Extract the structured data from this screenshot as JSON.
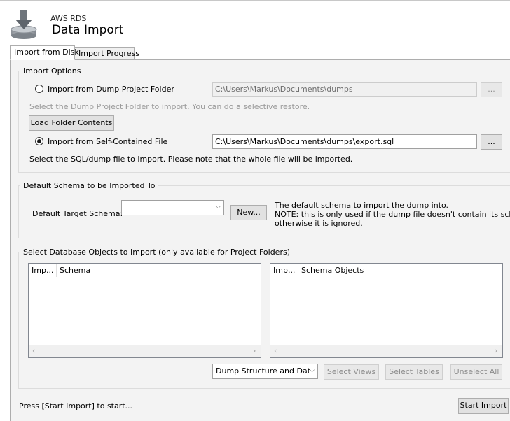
{
  "header": {
    "connection_name": "AWS RDS",
    "title": "Data Import"
  },
  "tabs": [
    {
      "label": "Import from Disk",
      "active": true
    },
    {
      "label": "Import Progress",
      "active": false
    }
  ],
  "import_options": {
    "title": "Import Options",
    "dump_folder_radio": "Import from Dump Project Folder",
    "dump_folder_path": "C:\\Users\\Markus\\Documents\\dumps",
    "dump_folder_browse": "...",
    "dump_folder_hint": "Select the Dump Project Folder to import. You can do a selective restore.",
    "load_folder_button": "Load Folder Contents",
    "self_contained_radio": "Import from Self-Contained File",
    "self_contained_path": "C:\\Users\\Markus\\Documents\\dumps\\export.sql",
    "self_contained_browse": "...",
    "self_contained_hint": "Select the SQL/dump file to import. Please note that the whole file will be imported.",
    "selected": "self_contained"
  },
  "default_schema": {
    "title": "Default Schema to be Imported To",
    "target_label": "Default Target Schema:",
    "target_value": "",
    "new_button": "New...",
    "note_line1": "The default schema to import the dump into.",
    "note_line2": "NOTE: this is only used if the dump file doesn't contain its schema,",
    "note_line3": "otherwise it is ignored."
  },
  "objects": {
    "title": "Select Database Objects to Import (only available for Project Folders)",
    "schema_list": {
      "col_import": "Imp...",
      "col_name": "Schema"
    },
    "objects_list": {
      "col_import": "Imp...",
      "col_name": "Schema Objects"
    },
    "dump_mode": "Dump Structure and Dat",
    "select_views": "Select Views",
    "select_tables": "Select Tables",
    "unselect_all": "Unselect All"
  },
  "footer": {
    "status": "Press [Start Import] to start...",
    "start_button": "Start Import"
  },
  "colors": {
    "panel_bg": "#f3f3f3",
    "border": "#adadad",
    "disabled_text": "#9a9a9a"
  }
}
